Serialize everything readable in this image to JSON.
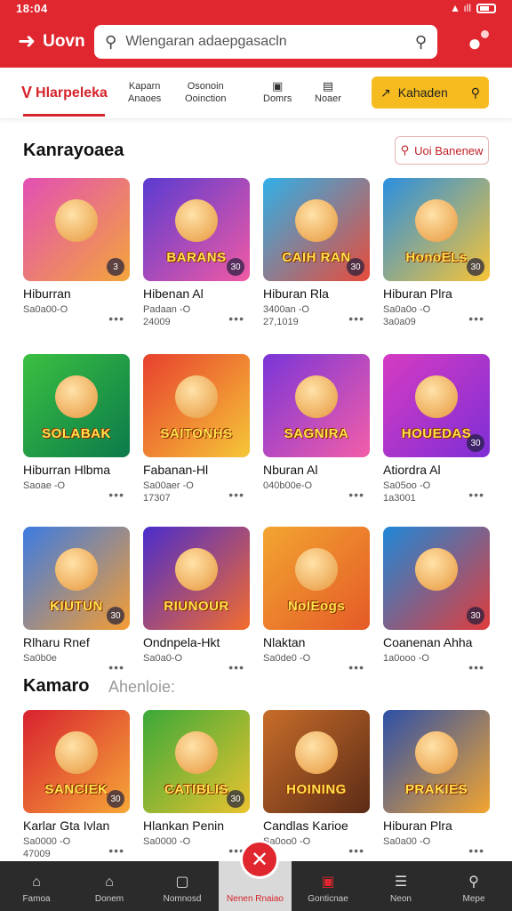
{
  "status": {
    "time": "18:04",
    "signal": "▲ ıll"
  },
  "header": {
    "back_label": "Uovn",
    "search_placeholder": "Wlengaran adaepgasacln",
    "brand_color": "#e0262e"
  },
  "tabs": {
    "main": "Hlarpeleka",
    "items": [
      {
        "label": "Kaparn",
        "sub": "Anaoes"
      },
      {
        "label": "Osonoin",
        "sub": "Ooinction"
      },
      {
        "label": "Domrs",
        "icon": "card-icon"
      },
      {
        "label": "Noaer",
        "icon": "screen-icon"
      }
    ],
    "promo": "Kahaden"
  },
  "section1": {
    "title": "Kanrayoaea",
    "filter": "Uoi Banenew"
  },
  "cards": [
    {
      "name": "Hiburran",
      "meta1": "Sa0a00-O",
      "meta2": "",
      "art": "",
      "bg": [
        "#e34fb5",
        "#f3a53b"
      ],
      "badge": "3"
    },
    {
      "name": "Hibenan Al",
      "meta1": "Padaan -O",
      "meta2": "24009",
      "art": "BARANS",
      "bg": [
        "#5a3bd1",
        "#f15aa4"
      ],
      "badge": "30"
    },
    {
      "name": "Hiburan Rla",
      "meta1": "3400an -O",
      "meta2": "27,1019",
      "art": "CAIH RAN",
      "bg": [
        "#2fb0e8",
        "#e84b3a"
      ],
      "badge": "30"
    },
    {
      "name": "Hiburan Plra",
      "meta1": "Sa0a0o -O",
      "meta2": "3a0a09",
      "art": "HonoELs",
      "bg": [
        "#2a8fe0",
        "#f7c436"
      ],
      "badge": "30"
    },
    {
      "name": "Hiburran Hlbma",
      "meta1": "Saoae -O",
      "meta2": "",
      "art": "SOLABAK",
      "bg": [
        "#3bc041",
        "#0b7a4a"
      ],
      "badge": ""
    },
    {
      "name": "Fabanan-Hl",
      "meta1": "Sa00aer -O",
      "meta2": "17307",
      "art": "SAITONHS",
      "bg": [
        "#e8402e",
        "#f6c637"
      ],
      "badge": ""
    },
    {
      "name": "Nburan Al",
      "meta1": "040b00e-O",
      "meta2": "",
      "art": "SAGNIRA",
      "bg": [
        "#7a35d8",
        "#f35ea8"
      ],
      "badge": ""
    },
    {
      "name": "Atiordra Al",
      "meta1": "Sa05oo -O",
      "meta2": "1a3001",
      "art": "HOUEDAS",
      "bg": [
        "#d63bc2",
        "#7e2ed6"
      ],
      "badge": "30"
    },
    {
      "name": "Rlharu Rnef",
      "meta1": "Sa0b0e",
      "meta2": "",
      "art": "KIUTUN",
      "bg": [
        "#3c7be3",
        "#f59d33"
      ],
      "badge": "30"
    },
    {
      "name": "Ondnpela-Hkt",
      "meta1": "Sa0a0-O",
      "meta2": "",
      "art": "RIUNOUR",
      "bg": [
        "#4b2ccc",
        "#f46c2d"
      ],
      "badge": ""
    },
    {
      "name": "Nlaktan",
      "meta1": "Sa0de0 -O",
      "meta2": "",
      "art": "NoIEogs",
      "bg": [
        "#f2a531",
        "#e55a27"
      ],
      "badge": ""
    },
    {
      "name": "Coanenan Ahha",
      "meta1": "1a0ooo -O",
      "meta2": "",
      "art": "",
      "bg": [
        "#1e88d8",
        "#e03c3c"
      ],
      "badge": "30"
    }
  ],
  "section2": {
    "title": "Kamaro",
    "sub": "Ahenloie:"
  },
  "cards2": [
    {
      "name": "Karlar Gta Ivlan",
      "meta1": "Sa0000 -O",
      "meta2": "47009",
      "art": "SANCIEK",
      "bg": [
        "#d8212f",
        "#f6a837"
      ],
      "badge": "30"
    },
    {
      "name": "Hlankan Penin",
      "meta1": "Sa0000 -O",
      "meta2": "",
      "art": "CATIBLIS",
      "bg": [
        "#3aa938",
        "#eac32f"
      ],
      "badge": "30"
    },
    {
      "name": "Candlas Karioe",
      "meta1": "Sa0oo0 -O",
      "meta2": "",
      "art": "HOINING",
      "bg": [
        "#c86d2a",
        "#5b2b16"
      ],
      "badge": ""
    },
    {
      "name": "Hiburan Plra",
      "meta1": "Sa0a00 -O",
      "meta2": "",
      "art": "PRAKIES",
      "bg": [
        "#2d4fa8",
        "#f3a530"
      ],
      "badge": ""
    }
  ],
  "bottom_nav": [
    {
      "label": "Famoa",
      "icon": "home-icon"
    },
    {
      "label": "Donem",
      "icon": "bank-icon"
    },
    {
      "label": "Nomnosd",
      "icon": "box-icon"
    },
    {
      "label": "Nenen Rnaiao",
      "icon": "close-icon",
      "active": true
    },
    {
      "label": "Gonticnae",
      "icon": "tv-icon"
    },
    {
      "label": "Neon",
      "icon": "list-icon"
    },
    {
      "label": "Mepe",
      "icon": "search-icon"
    }
  ]
}
